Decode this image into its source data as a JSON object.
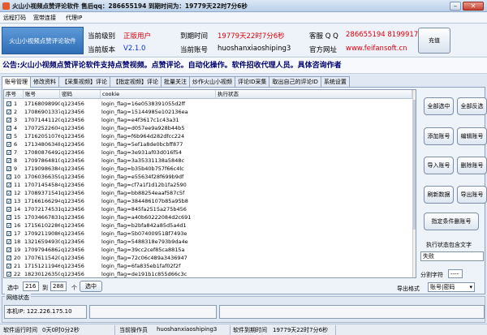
{
  "window": {
    "title": "火山小视频点赞评论软件 售后qq：286655194 到期时间为：19779天22时7分6秒"
  },
  "menu": [
    "远程打码",
    "宽带连接",
    "代理IP"
  ],
  "header": {
    "logo_text": "火山小视频点赞评论软件",
    "level_label": "当前级别",
    "level_value": "正版用户",
    "version_label": "当前版本",
    "version_value": "V2.1.0",
    "expiry_label": "到期时间",
    "expiry_value": "19779天22时7分6秒",
    "account_label": "当前账号",
    "account_value": "huoshanxiaoshiping3",
    "service_label": "客服 Q Q",
    "service_value": "286655194 8199917",
    "site_label": "官方网址",
    "site_value": "www.feifansoft.cn",
    "recharge_label": "充值"
  },
  "notice": "公告:火山小视频点赞评论软件支持点赞视频。点赞评论。自动化操作。软件招收代理人员。具体咨询作者",
  "tabs": [
    "账号管理",
    "修改资料",
    "【采集视频】评论",
    "【指定视频】评论",
    "批量关注",
    "炒作火山小视频",
    "评论ID采集",
    "取出自己的评论ID",
    "系统设置"
  ],
  "table": {
    "columns": [
      "序号",
      "账号",
      "密码",
      "cookie",
      "执行状态"
    ],
    "rows": [
      {
        "no": "1",
        "account": "17168098990",
        "password": "q123456",
        "cookie": "login_flag=16e0538391055d2ff"
      },
      {
        "no": "2",
        "account": "17086901337",
        "password": "q123456",
        "cookie": "login_flag=15144985e102136ea"
      },
      {
        "no": "3",
        "account": "17071441120",
        "password": "q123456",
        "cookie": "login_flag=e4f3617c1c43a31"
      },
      {
        "no": "4",
        "account": "17072522604",
        "password": "q123456",
        "cookie": "login_flag=d057ee9a928b44b5"
      },
      {
        "no": "5",
        "account": "17162051076",
        "password": "q123456",
        "cookie": "login_flag=f6b964d282dfcc224"
      },
      {
        "no": "6",
        "account": "17134806348",
        "password": "q123456",
        "cookie": "login_flag=5ef1a8de0bcbff877"
      },
      {
        "no": "7",
        "account": "17080876492",
        "password": "q123456",
        "cookie": "login_flag=3e931af03d016f54"
      },
      {
        "no": "8",
        "account": "17097864810",
        "password": "q123456",
        "cookie": "login_flag=3a35331138a5848c"
      },
      {
        "no": "9",
        "account": "17190986384",
        "password": "q123456",
        "cookie": "login_flag=b35b40b757f66c4lc"
      },
      {
        "no": "10",
        "account": "17060366359",
        "password": "q123456",
        "cookie": "login_flag=e55634f28f699b9df"
      },
      {
        "no": "11",
        "account": "17071454584",
        "password": "q123456",
        "cookie": "login_flag=cf7a1f1d12b1fa2590"
      },
      {
        "no": "12",
        "account": "17089371541",
        "password": "q123456",
        "cookie": "login_flag=bb88254eaaf587c5f"
      },
      {
        "no": "13",
        "account": "17166166294",
        "password": "q123456",
        "cookie": "login_flag=384486107b85a95b8"
      },
      {
        "no": "14",
        "account": "17072174531",
        "password": "q123456",
        "cookie": "login_flag=845fa2515a275b456"
      },
      {
        "no": "15",
        "account": "17034667831",
        "password": "q123456",
        "cookie": "login_flag=a40b60222084d2c691"
      },
      {
        "no": "16",
        "account": "17156102286",
        "password": "q123456",
        "cookie": "login_flag=b2bfa842a85d5a4d1"
      },
      {
        "no": "17",
        "account": "17092119086",
        "password": "q123456",
        "cookie": "login_flag=5b07400951Bf7493e"
      },
      {
        "no": "18",
        "account": "13216594930",
        "password": "q123456",
        "cookie": "login_flag=5488318e793b9da4e"
      },
      {
        "no": "19",
        "account": "17097946862",
        "password": "q123456",
        "cookie": "login_flag=39cc2cef85ca8815a"
      },
      {
        "no": "20",
        "account": "17076115420",
        "password": "q123456",
        "cookie": "login_flag=72c06c489a3436947"
      },
      {
        "no": "21",
        "account": "17151211946",
        "password": "q123456",
        "cookie": "login_flag=6fa835eb1faf02f2f"
      },
      {
        "no": "22",
        "account": "18230126350",
        "password": "q123456",
        "cookie": "login_flag=de191b1c855d66c3c"
      }
    ]
  },
  "actions": {
    "select_all": "全部选中",
    "invert_all": "全部反选",
    "add": "添加账号",
    "edit": "编辑账号",
    "import": "导入账号",
    "delete": "删除账号",
    "refresh": "刷新数据",
    "export": "导出账号",
    "delete_by_condition": "指定条件删账号",
    "status_contains_label": "执行状态包含文字",
    "status_contains_value": "失败",
    "separator_label": "分割字符",
    "separator_value": "----",
    "export_format_label": "导出格式",
    "export_format_value": "账号|密码"
  },
  "selection": {
    "select_label": "选中",
    "from": "216",
    "to": "288",
    "unit": "个",
    "select_button": "选中"
  },
  "network": {
    "group_label": "网络状态",
    "ip_label": "本机IP: 122.226.175.10"
  },
  "statusbar": {
    "runtime_label": "软件运行时间",
    "runtime_value": "0天0时0分2秒",
    "operator_label": "当前操作员",
    "operator_value": "huoshanxiaoshiping3",
    "expiry_label": "软件到期时间",
    "expiry_value": "19779天22时7分6秒"
  }
}
